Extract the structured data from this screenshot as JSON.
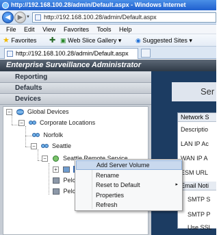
{
  "browser": {
    "window_title": "http://192.168.100.28/admin/Default.aspx - Windows Internet",
    "address": "http://192.168.100.28/admin/Default.aspx",
    "menu": [
      "File",
      "Edit",
      "View",
      "Favorites",
      "Tools",
      "Help"
    ],
    "favorites_label": "Favorites",
    "web_slice": "Web Slice Gallery",
    "suggested_sites": "Suggested Sites",
    "tab_title": "http://192.168.100.28/admin/Default.aspx"
  },
  "app": {
    "header": "Enterprise Surveillance Administrator",
    "accordion": [
      "Reporting",
      "Defaults",
      "Devices"
    ]
  },
  "tree": {
    "global": "Global Devices",
    "corporate": "Corporate Locations",
    "norfolk": "Norfolk",
    "seattle": "Seattle",
    "remote": "Seattle Remote Service",
    "selected_partial": "I",
    "pelc1": "Pelc",
    "pelc2": "Pelc"
  },
  "context_menu": {
    "items": [
      "Add Server Volume",
      "Rename",
      "Reset to Default",
      "Properties",
      "Refresh"
    ],
    "highlighted_index": 0,
    "submenu_arrow": "▸"
  },
  "right": {
    "title": "Ser",
    "section1": "Network S",
    "rows1": [
      "Descriptio",
      "LAN IP Ac",
      "WAN IP A",
      "ESM URL"
    ],
    "section2": "Email Noti",
    "rows2": [
      "SMTP S",
      "SMTP P",
      "Use SSL"
    ]
  },
  "colors": {
    "app_header": "#2f3a47",
    "right_pane": "#1c3c62",
    "menu_highlight": "#c9d9ee"
  }
}
